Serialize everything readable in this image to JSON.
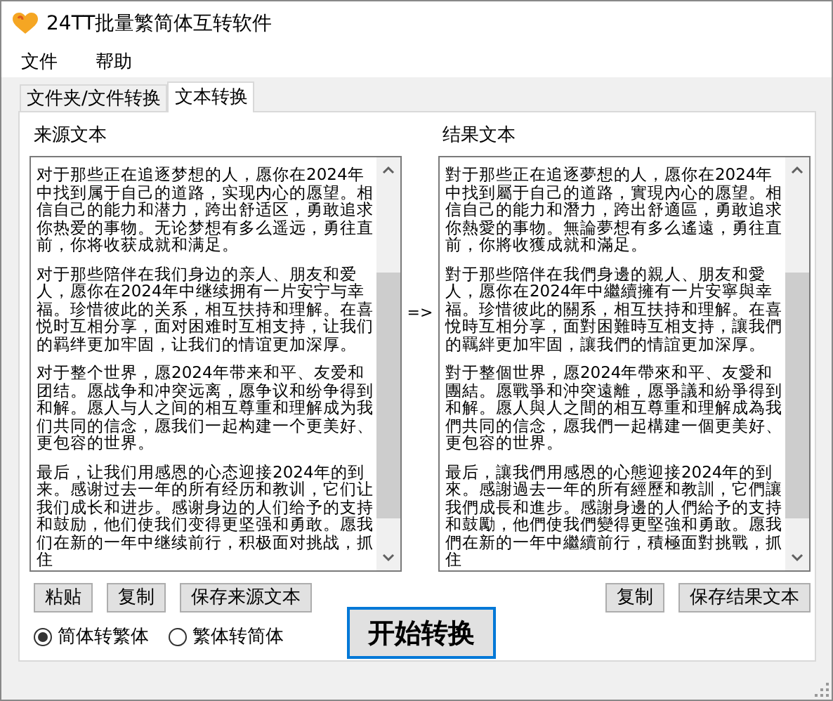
{
  "window": {
    "title": "24TT批量繁简体互转软件"
  },
  "menu": [
    {
      "label": "文件"
    },
    {
      "label": "帮助"
    }
  ],
  "tabs": [
    {
      "label": "文件夹/文件转换",
      "selected": false
    },
    {
      "label": "文本转换",
      "selected": true
    }
  ],
  "source": {
    "label": "来源文本",
    "paragraphs": [
      "对于那些正在追逐梦想的人，愿你在2024年中找到属于自己的道路，实现内心的愿望。相信自己的能力和潜力，跨出舒适区，勇敢追求你热爱的事物。无论梦想有多么遥远，勇往直前，你将收获成就和满足。",
      "对于那些陪伴在我们身边的亲人、朋友和爱人，愿你在2024年中继续拥有一片安宁与幸福。珍惜彼此的关系，相互扶持和理解。在喜悦时互相分享，面对困难时互相支持，让我们的羁绊更加牢固，让我们的情谊更加深厚。",
      "对于整个世界，愿2024年带来和平、友爱和团结。愿战争和冲突远离，愿争议和纷争得到和解。愿人与人之间的相互尊重和理解成为我们共同的信念，愿我们一起构建一个更美好、更包容的世界。",
      "最后，让我们用感恩的心态迎接2024年的到来。感谢过去一年的所有经历和教训，它们让我们成长和进步。感谢身边的人们给予的支持和鼓励，他们使我们变得更坚强和勇敢。愿我们在新的一年中继续前行，积极面对挑战，抓住"
    ]
  },
  "arrow": "=>",
  "result": {
    "label": "结果文本",
    "paragraphs": [
      "對于那些正在追逐夢想的人，愿你在2024年中找到屬于自己的道路，實現內心的愿望。相信自己的能力和潛力，跨出舒適區，勇敢追求你熱愛的事物。無論夢想有多么遙遠，勇往直前，你將收獲成就和滿足。",
      "對于那些陪伴在我們身邊的親人、朋友和愛人，愿你在2024年中繼續擁有一片安寧與幸福。珍惜彼此的關系，相互扶持和理解。在喜悅時互相分享，面對困難時互相支持，讓我們的羈絆更加牢固，讓我們的情誼更加深厚。",
      "對于整個世界，愿2024年帶來和平、友愛和團結。愿戰爭和沖突遠離，愿爭議和紛爭得到和解。愿人與人之間的相互尊重和理解成為我們共同的信念，愿我們一起構建一個更美好、更包容的世界。",
      "最后，讓我們用感恩的心態迎接2024年的到來。感謝過去一年的所有經歷和教訓，它們讓我們成長和進步。感謝身邊的人們給予的支持和鼓勵，他們使我們變得更堅強和勇敢。愿我們在新的一年中繼續前行，積極面對挑戰，抓住"
    ]
  },
  "source_buttons": [
    "粘贴",
    "复制",
    "保存来源文本"
  ],
  "result_buttons": [
    "复制",
    "保存结果文本"
  ],
  "modes": [
    {
      "label": "简体转繁体",
      "selected": true
    },
    {
      "label": "繁体转简体",
      "selected": false
    }
  ],
  "start_button": "开始转换"
}
